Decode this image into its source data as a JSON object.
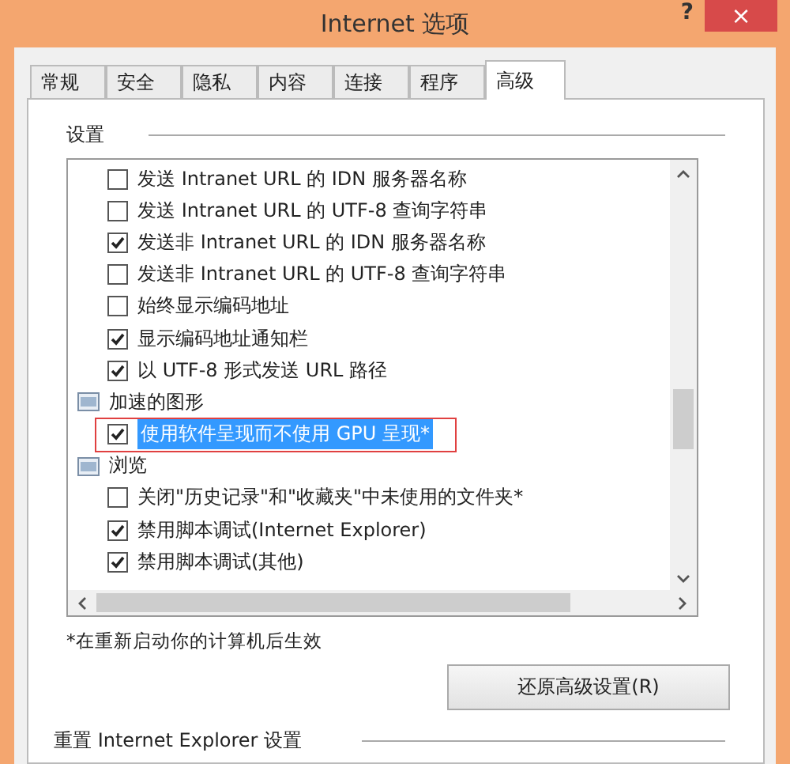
{
  "window": {
    "title": "Internet 选项",
    "help": "?",
    "close": "×"
  },
  "tabs": [
    {
      "label": "常规",
      "selected": false
    },
    {
      "label": "安全",
      "selected": false
    },
    {
      "label": "隐私",
      "selected": false
    },
    {
      "label": "内容",
      "selected": false
    },
    {
      "label": "连接",
      "selected": false
    },
    {
      "label": "程序",
      "selected": false
    },
    {
      "label": "高级",
      "selected": true
    }
  ],
  "settings": {
    "heading": "设置",
    "items": [
      {
        "kind": "option",
        "label": "发送 Intranet URL 的 IDN 服务器名称",
        "checked": false,
        "selected": false
      },
      {
        "kind": "option",
        "label": "发送 Intranet URL 的 UTF-8 查询字符串",
        "checked": false,
        "selected": false
      },
      {
        "kind": "option",
        "label": "发送非 Intranet URL 的 IDN 服务器名称",
        "checked": true,
        "selected": false
      },
      {
        "kind": "option",
        "label": "发送非 Intranet URL 的 UTF-8 查询字符串",
        "checked": false,
        "selected": false
      },
      {
        "kind": "option",
        "label": "始终显示编码地址",
        "checked": false,
        "selected": false
      },
      {
        "kind": "option",
        "label": "显示编码地址通知栏",
        "checked": true,
        "selected": false
      },
      {
        "kind": "option",
        "label": "以 UTF-8 形式发送 URL 路径",
        "checked": true,
        "selected": false
      },
      {
        "kind": "group",
        "label": "加速的图形"
      },
      {
        "kind": "option",
        "label": "使用软件呈现而不使用 GPU 呈现*",
        "checked": true,
        "selected": true
      },
      {
        "kind": "group",
        "label": "浏览"
      },
      {
        "kind": "option",
        "label": "关闭\"历史记录\"和\"收藏夹\"中未使用的文件夹*",
        "checked": false,
        "selected": false
      },
      {
        "kind": "option",
        "label": "禁用脚本调试(Internet Explorer)",
        "checked": true,
        "selected": false
      },
      {
        "kind": "option",
        "label": "禁用脚本调试(其他)",
        "checked": true,
        "selected": false
      }
    ],
    "footnote": "*在重新启动你的计算机后生效",
    "restore_button": "还原高级设置(R)"
  },
  "reset_section": {
    "heading": "重置 Internet Explorer 设置"
  }
}
